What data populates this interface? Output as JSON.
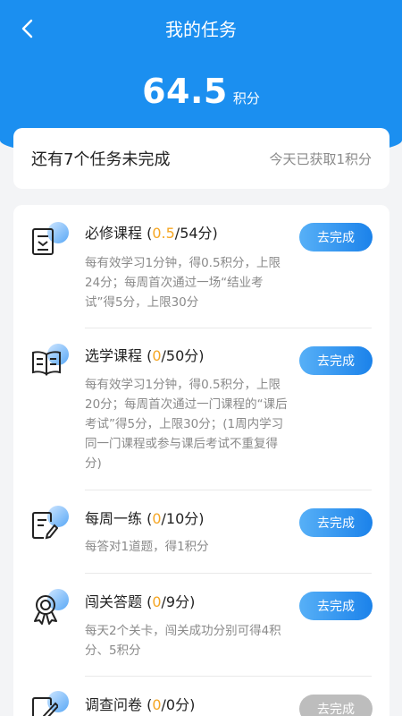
{
  "header": {
    "title": "我的任务",
    "points": "64.5",
    "points_unit": "积分"
  },
  "summary": {
    "remaining": "还有7个任务未完成",
    "today": "今天已获取1积分"
  },
  "tasks": [
    {
      "name": "必修课程",
      "open": " (",
      "got": "0.5",
      "rest": "/54分)",
      "desc": "每有效学习1分钟，得0.5积分，上限24分；每周首次通过一场“结业考试”得5分，上限30分",
      "button": "去完成",
      "icon": "document-icon"
    },
    {
      "name": "选学课程",
      "open": " (",
      "got": "0",
      "rest": "/50分)",
      "desc": "每有效学习1分钟，得0.5积分，上限20分；每周首次通过一门课程的“课后考试”得5分，上限30分；(1周内学习同一门课程或参与课后考试不重复得分)",
      "button": "去完成",
      "icon": "book-icon"
    },
    {
      "name": "每周一练",
      "open": " (",
      "got": "0",
      "rest": "/10分)",
      "desc": "每答对1道题，得1积分",
      "button": "去完成",
      "icon": "edit-note-icon"
    },
    {
      "name": "闯关答题",
      "open": " (",
      "got": "0",
      "rest": "/9分)",
      "desc": "每天2个关卡，闯关成功分别可得4积分、5积分",
      "button": "去完成",
      "icon": "medal-icon"
    },
    {
      "name": "调查问卷",
      "open": " (",
      "got": "0",
      "rest": "/0分)",
      "desc": "",
      "button": "去完成",
      "icon": "survey-icon"
    }
  ]
}
